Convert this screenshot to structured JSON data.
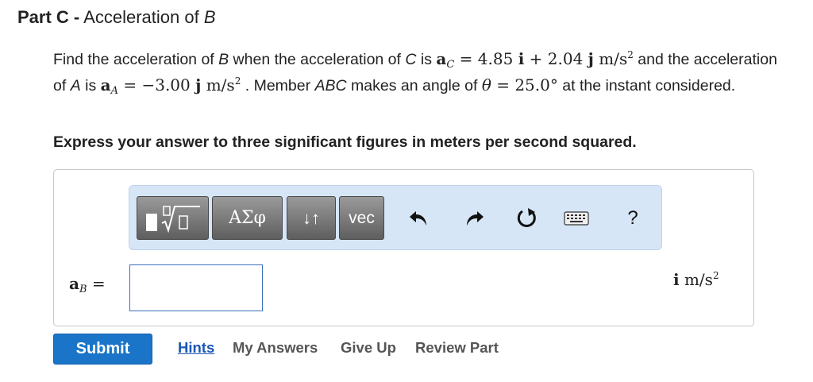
{
  "part": {
    "label": "Part C",
    "separator": "-",
    "title_prefix": "Acceleration of",
    "title_var": "B"
  },
  "problem": {
    "t1": "Find the acceleration of ",
    "v1": "B",
    "t2": " when the acceleration of ",
    "v2": "C",
    "t3": " is ",
    "aC_bold": "a",
    "aC_sub": "C",
    "aC_eq": " = 4.85 ",
    "i1": "i",
    "aC_plus": " + 2.04 ",
    "j1": "j",
    "aC_unit": " m/s",
    "sq": "2",
    "t4": " and the acceleration of ",
    "v3": "A",
    "t5": " is ",
    "aA_bold": "a",
    "aA_sub": "A",
    "aA_eq": " = −3.00 ",
    "j2": "j",
    "aA_unit": " m/s",
    "t6": " . Member ",
    "v4": "ABC",
    "t7": " makes an angle of ",
    "theta": "θ",
    "theta_eq": " = 25.0°",
    "t8": " at the instant considered."
  },
  "instruction": "Express your answer to three significant figures in meters per second squared.",
  "toolbar": {
    "greek": "ΑΣφ",
    "arrows": "↓↑",
    "vec": "vec",
    "help": "?"
  },
  "answer": {
    "lhs_bold": "a",
    "lhs_sub": "B",
    "lhs_eq": " =",
    "value": "",
    "unit_bold": "i",
    "unit_text": " m/s",
    "unit_sup": "2"
  },
  "actions": {
    "submit": "Submit",
    "hints": "Hints",
    "my_answers": "My Answers",
    "give_up": "Give Up",
    "review_part": "Review Part"
  },
  "colors": {
    "toolbar_bg": "#d6e6f7",
    "submit_bg": "#1a75c9",
    "link_blue": "#1a56b5",
    "input_border": "#3a6fbf"
  }
}
